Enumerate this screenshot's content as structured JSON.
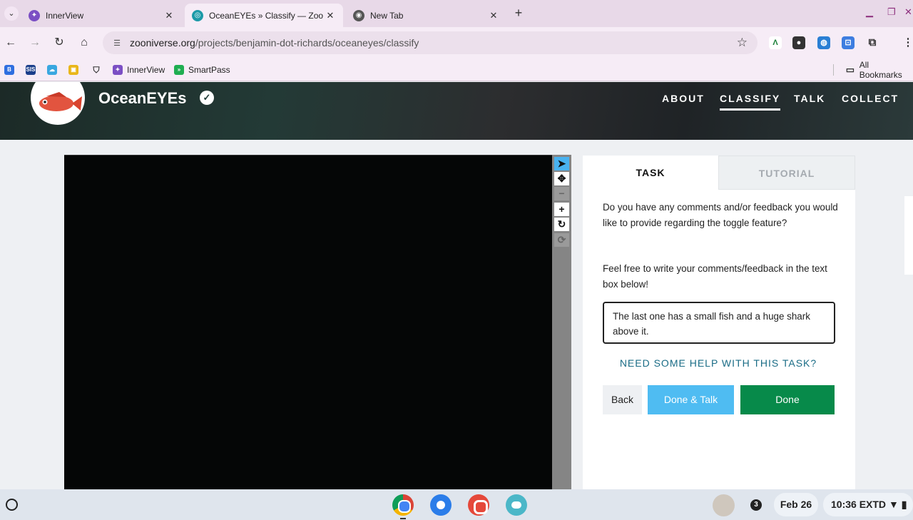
{
  "browser": {
    "tabs": [
      {
        "title": "InnerView",
        "close": "✕"
      },
      {
        "title": "OceanEYEs » Classify — Zooniverse",
        "close": "✕"
      },
      {
        "title": "New Tab",
        "close": "✕"
      }
    ],
    "new_tab": "+",
    "address": {
      "domain": "zooniverse.org",
      "path": "/projects/benjamin-dot-richards/oceaneyes/classify"
    },
    "bookmarks": [
      {
        "label": "InnerView"
      },
      {
        "label": "SmartPass"
      }
    ],
    "all_bookmarks": "All Bookmarks"
  },
  "project": {
    "title": "OceanEYEs",
    "nav": [
      "ABOUT",
      "CLASSIFY",
      "TALK",
      "COLLECT"
    ],
    "active_nav": "CLASSIFY"
  },
  "task_panel": {
    "tabs": [
      "TASK",
      "TUTORIAL"
    ],
    "active_tab": "TASK",
    "question": "Do you have any comments and/or feedback you would like to provide regarding the toggle feature?",
    "instruction": "Feel free to write your comments/feedback in the text box below!",
    "answer": "The last one has a small fish and a huge shark above it.",
    "help_link": "NEED SOME HELP WITH THIS TASK?",
    "buttons": {
      "back": "Back",
      "done_talk": "Done & Talk",
      "done": "Done"
    }
  },
  "viewer_tools": [
    "pointer-icon",
    "pan-icon",
    "zoom-out-icon",
    "zoom-in-icon",
    "rotate-icon",
    "reset-icon"
  ],
  "shelf": {
    "notification_count": "3",
    "date": "Feb 26",
    "time": "10:36",
    "status": "EXTD"
  },
  "colors": {
    "done": "#078a4a",
    "done_talk": "#4fbcf2",
    "help_link": "#1a6c86",
    "tool_active": "#48b2f0"
  }
}
